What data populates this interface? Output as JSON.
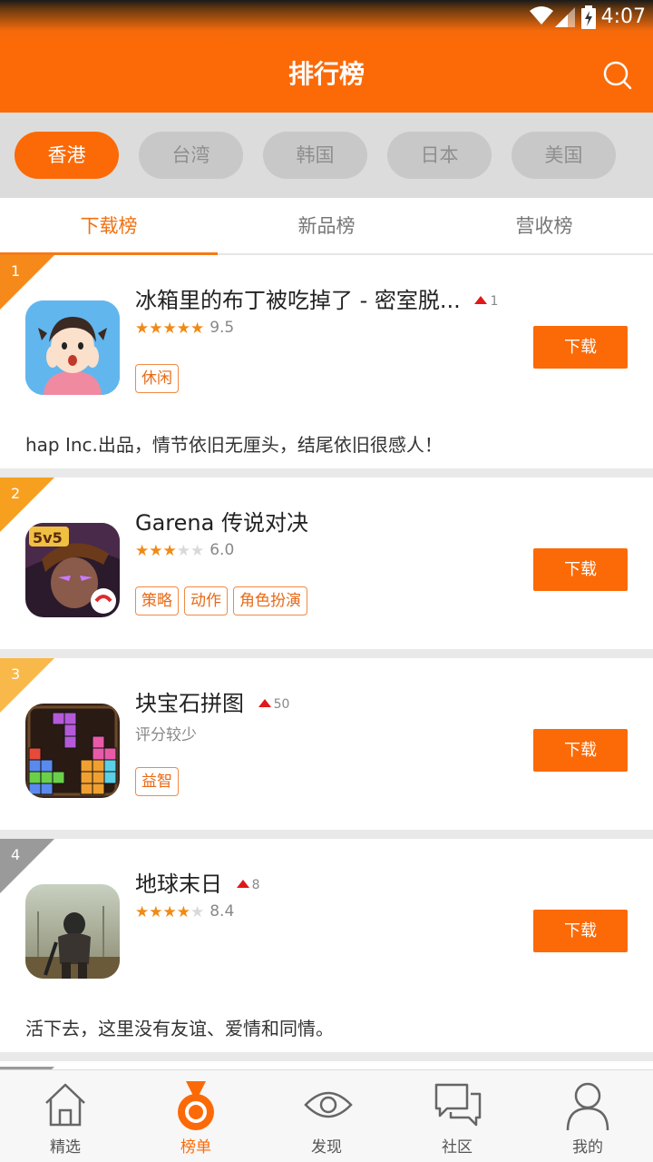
{
  "status_bar": {
    "time": "4:07"
  },
  "header": {
    "title": "排行榜"
  },
  "regions": [
    {
      "label": "香港",
      "active": true
    },
    {
      "label": "台湾",
      "active": false
    },
    {
      "label": "韩国",
      "active": false
    },
    {
      "label": "日本",
      "active": false
    },
    {
      "label": "美国",
      "active": false
    }
  ],
  "tabs": [
    {
      "label": "下载榜",
      "active": true
    },
    {
      "label": "新品榜",
      "active": false
    },
    {
      "label": "营收榜",
      "active": false
    }
  ],
  "apps": [
    {
      "rank": "1",
      "name": "冰箱里的布丁被吃掉了 - 密室脱...",
      "trend": "1",
      "stars": 5,
      "score": "9.5",
      "tags": [
        "休闲"
      ],
      "button": "下载",
      "desc": "hap Inc.出品，情节依旧无厘头，结尾依旧很感人！",
      "rank_color": "#f58a1a"
    },
    {
      "rank": "2",
      "name": "Garena 传说对决",
      "trend": "",
      "stars": 3,
      "score": "6.0",
      "tags": [
        "策略",
        "动作",
        "角色扮演"
      ],
      "button": "下载",
      "desc": "",
      "rank_color": "#f7a020"
    },
    {
      "rank": "3",
      "name": "块宝石拼图",
      "trend": "50",
      "stars": 0,
      "score": "",
      "rating_text": "评分较少",
      "tags": [
        "益智"
      ],
      "button": "下载",
      "desc": "",
      "rank_color": "#f9b84a"
    },
    {
      "rank": "4",
      "name": "地球末日",
      "trend": "8",
      "stars": 4,
      "score": "8.4",
      "tags": [],
      "button": "下载",
      "desc": "活下去，这里没有友谊、爱情和同情。",
      "rank_color": "#9a9a9a"
    }
  ],
  "bottom_nav": [
    {
      "label": "精选",
      "icon": "home-icon",
      "active": false
    },
    {
      "label": "榜单",
      "icon": "medal-icon",
      "active": true
    },
    {
      "label": "发现",
      "icon": "eye-icon",
      "active": false
    },
    {
      "label": "社区",
      "icon": "chat-icon",
      "active": false
    },
    {
      "label": "我的",
      "icon": "user-icon",
      "active": false
    }
  ],
  "colors": {
    "accent": "#fb6a07",
    "tag_border": "#f08a44",
    "trend_up": "#e01818"
  }
}
